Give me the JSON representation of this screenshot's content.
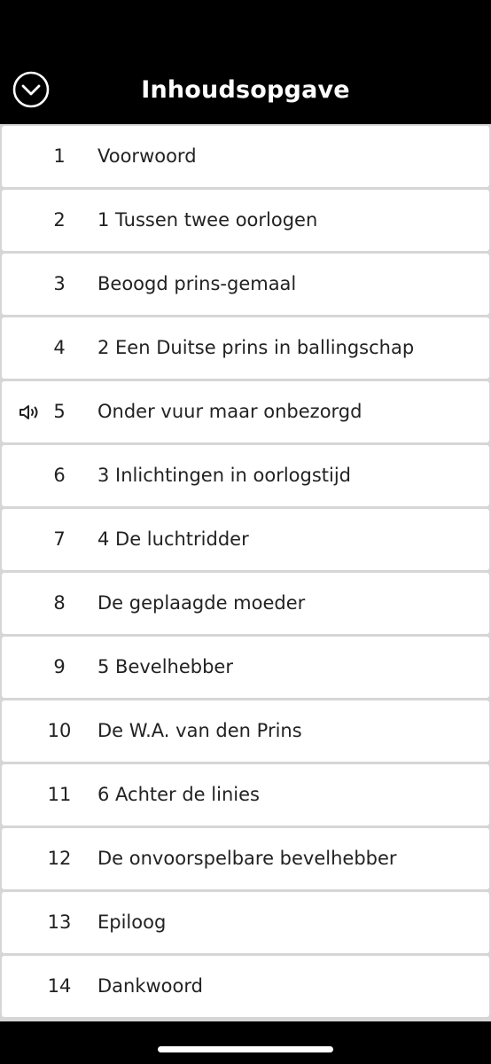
{
  "header": {
    "title": "Inhoudsopgave",
    "close_icon": "chevron-down-circle-icon",
    "background": "#000000",
    "text_color": "#ffffff"
  },
  "toc": {
    "items": [
      {
        "number": "1",
        "title": "Voorwoord",
        "playing": false
      },
      {
        "number": "2",
        "title": "1 Tussen twee oorlogen",
        "playing": false
      },
      {
        "number": "3",
        "title": "Beoogd prins-gemaal",
        "playing": false
      },
      {
        "number": "4",
        "title": "2 Een Duitse prins in ballingschap",
        "playing": false
      },
      {
        "number": "5",
        "title": "Onder vuur maar onbezorgd",
        "playing": true
      },
      {
        "number": "6",
        "title": "3 Inlichtingen in oorlogstijd",
        "playing": false
      },
      {
        "number": "7",
        "title": "4 De luchtridder",
        "playing": false
      },
      {
        "number": "8",
        "title": "De geplaagde moeder",
        "playing": false
      },
      {
        "number": "9",
        "title": "5 Bevelhebber",
        "playing": false
      },
      {
        "number": "10",
        "title": "De W.A. van den Prins",
        "playing": false
      },
      {
        "number": "11",
        "title": "6 Achter de linies",
        "playing": false
      },
      {
        "number": "12",
        "title": "De onvoorspelbare bevelhebber",
        "playing": false
      },
      {
        "number": "13",
        "title": "Epiloog",
        "playing": false
      },
      {
        "number": "14",
        "title": "Dankwoord",
        "playing": false
      }
    ],
    "playing_icon": "speaker-icon",
    "row_background": "#ffffff",
    "separator_color": "#d6d6d6",
    "text_color": "#222222"
  }
}
